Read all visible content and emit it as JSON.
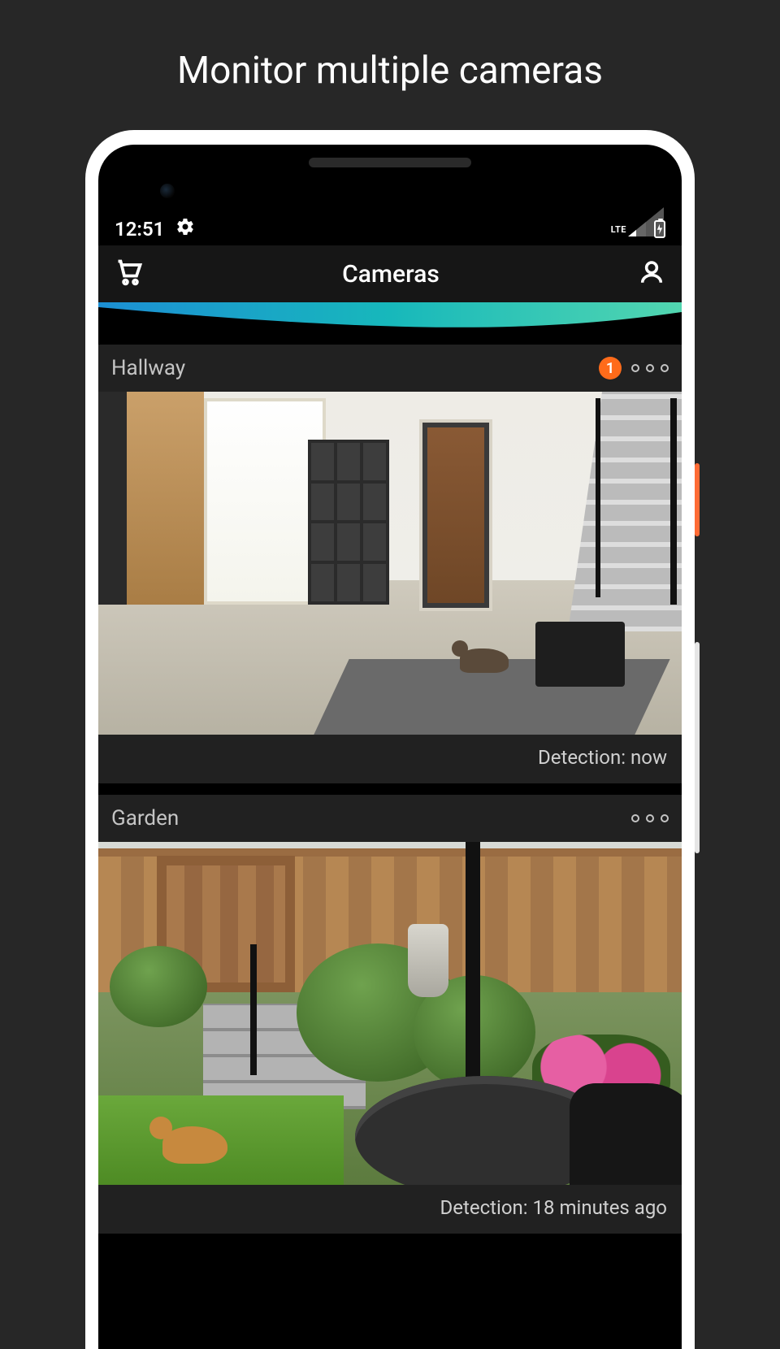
{
  "promo": {
    "title": "Monitor multiple cameras"
  },
  "statusbar": {
    "time": "12:51",
    "network": "LTE"
  },
  "header": {
    "title": "Cameras"
  },
  "cameras": [
    {
      "name": "Hallway",
      "badge": "1",
      "detection": "Detection: now"
    },
    {
      "name": "Garden",
      "badge": "",
      "detection": "Detection: 18 minutes ago"
    }
  ]
}
